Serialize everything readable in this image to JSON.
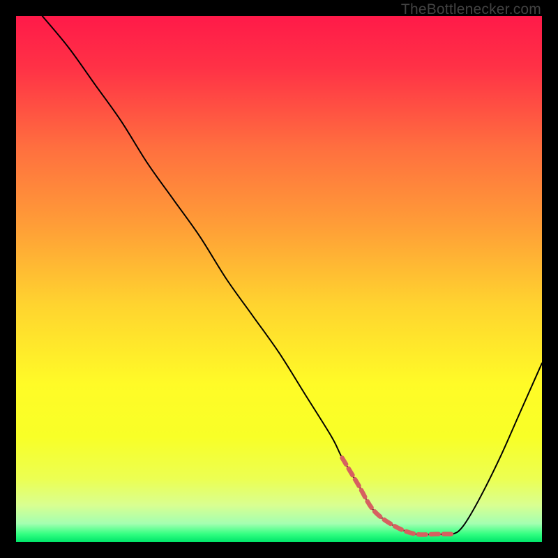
{
  "watermark": "TheBottlenecker.com",
  "chart_data": {
    "type": "line",
    "title": "",
    "xlabel": "",
    "ylabel": "",
    "xlim": [
      0,
      100
    ],
    "ylim": [
      0,
      100
    ],
    "grid": false,
    "legend": false,
    "background_gradient": {
      "stops": [
        {
          "offset": 0.0,
          "color": "#ff1a49"
        },
        {
          "offset": 0.1,
          "color": "#ff3246"
        },
        {
          "offset": 0.25,
          "color": "#ff6f3f"
        },
        {
          "offset": 0.4,
          "color": "#ff9e37"
        },
        {
          "offset": 0.55,
          "color": "#ffd42f"
        },
        {
          "offset": 0.7,
          "color": "#fffb27"
        },
        {
          "offset": 0.8,
          "color": "#f8ff27"
        },
        {
          "offset": 0.88,
          "color": "#ecff52"
        },
        {
          "offset": 0.93,
          "color": "#d9ff91"
        },
        {
          "offset": 0.965,
          "color": "#a4ffb1"
        },
        {
          "offset": 0.985,
          "color": "#33ff81"
        },
        {
          "offset": 1.0,
          "color": "#00e56a"
        }
      ]
    },
    "series": [
      {
        "name": "bottleneck-curve",
        "color": "#000000",
        "stroke_width": 2.0,
        "x": [
          5,
          10,
          15,
          20,
          25,
          30,
          35,
          40,
          45,
          50,
          55,
          60,
          62,
          65,
          68,
          72,
          76,
          80,
          83,
          85,
          88,
          92,
          96,
          100
        ],
        "y": [
          100,
          94,
          87,
          80,
          72,
          65,
          58,
          50,
          43,
          36,
          28,
          20,
          16,
          11,
          6,
          3,
          1.5,
          1.5,
          1.5,
          3,
          8,
          16,
          25,
          34
        ]
      },
      {
        "name": "optimal-zone",
        "color": "#d66060",
        "stroke_width": 6.5,
        "dash": [
          11,
          7
        ],
        "x": [
          62,
          65,
          68,
          72,
          76,
          80,
          83
        ],
        "y": [
          16,
          11,
          6,
          3,
          1.5,
          1.5,
          1.5
        ]
      }
    ]
  }
}
